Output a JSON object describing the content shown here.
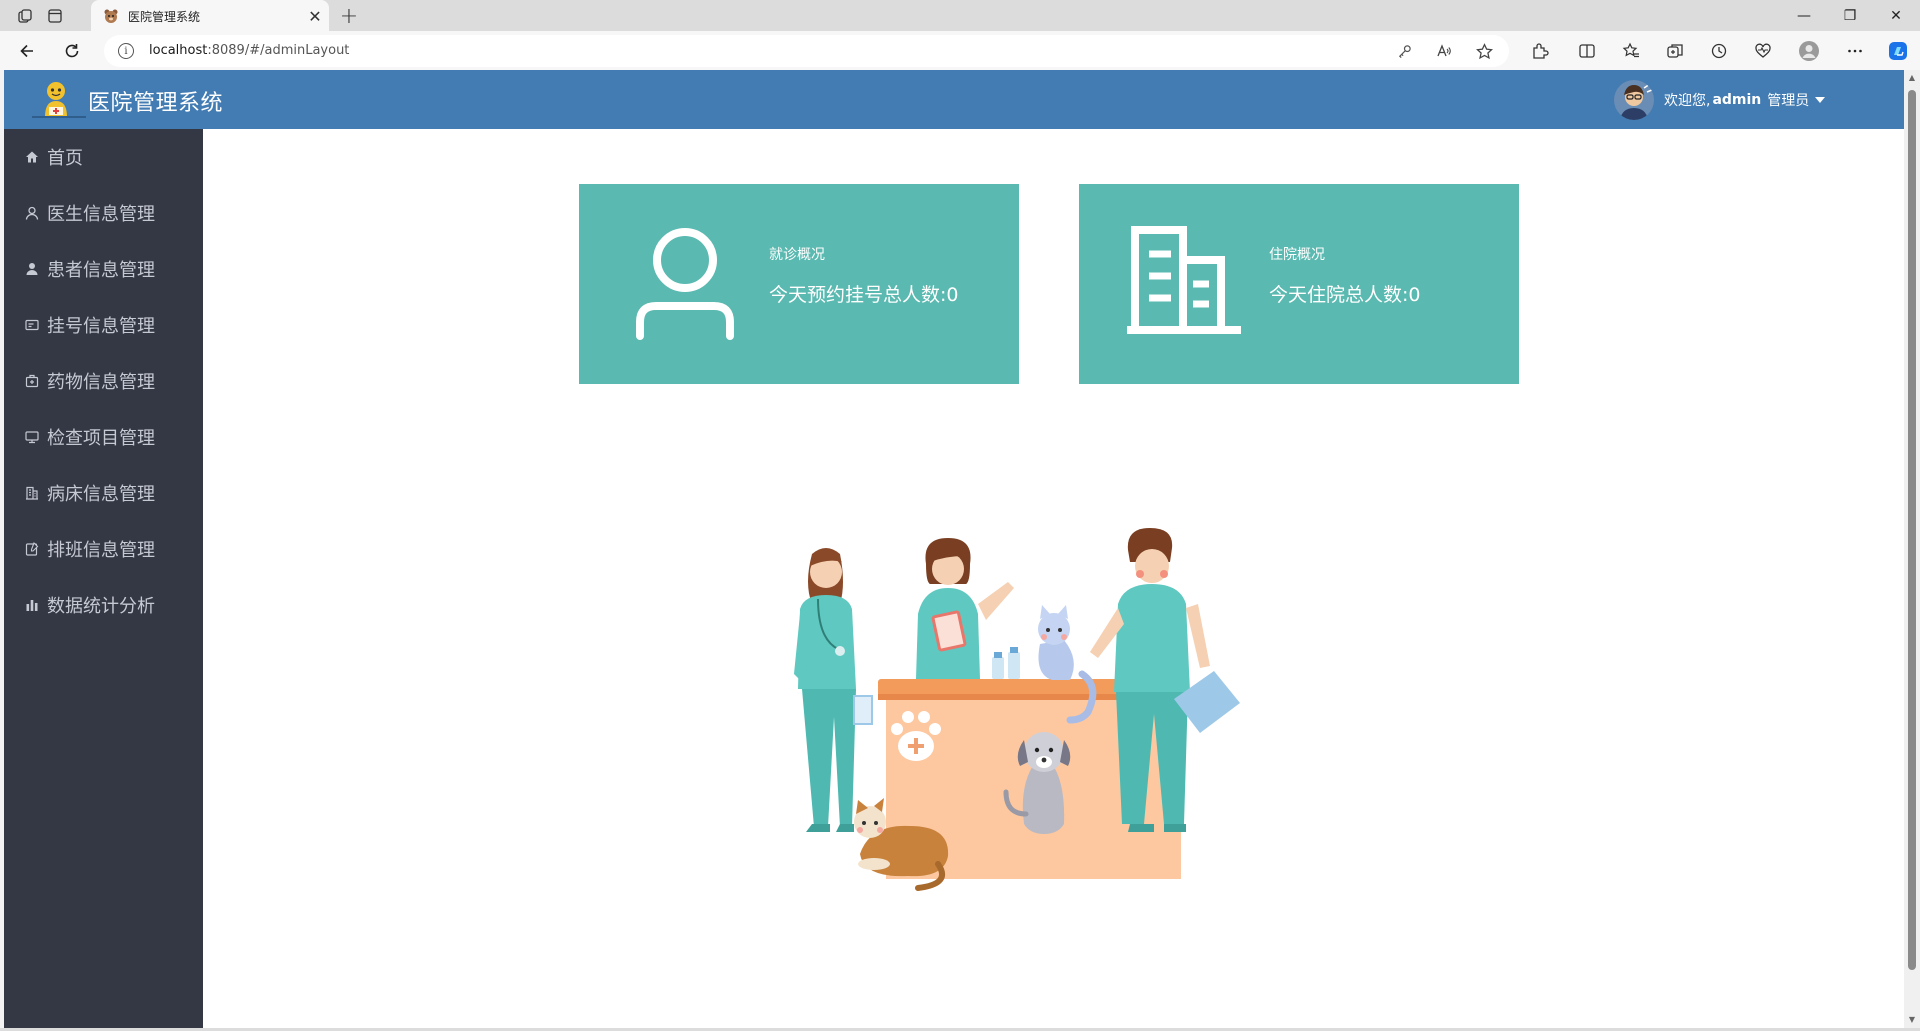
{
  "browser": {
    "tab_title": "医院管理系统",
    "tab_close": "✕",
    "new_tab": "+",
    "url_host": "localhost",
    "url_rest": ":8089/#/adminLayout",
    "info_icon": "i",
    "window_controls": {
      "minimize": "—",
      "restore": "❐",
      "close": "✕"
    }
  },
  "header": {
    "title": "医院管理系统",
    "welcome": "欢迎您,",
    "username": "admin",
    "role": "管理员"
  },
  "sidebar": {
    "items": [
      {
        "label": "首页",
        "icon": "home-icon"
      },
      {
        "label": "医生信息管理",
        "icon": "user-outline-icon"
      },
      {
        "label": "患者信息管理",
        "icon": "user-solid-icon"
      },
      {
        "label": "挂号信息管理",
        "icon": "ticket-icon"
      },
      {
        "label": "药物信息管理",
        "icon": "medicine-box-icon"
      },
      {
        "label": "检查项目管理",
        "icon": "monitor-icon"
      },
      {
        "label": "病床信息管理",
        "icon": "building-icon"
      },
      {
        "label": "排班信息管理",
        "icon": "calendar-edit-icon"
      },
      {
        "label": "数据统计分析",
        "icon": "bar-chart-icon"
      }
    ]
  },
  "cards": [
    {
      "heading": "就诊概况",
      "stat": "今天预约挂号总人数:0",
      "icon": "user-icon",
      "color": "#5ab9b0"
    },
    {
      "heading": "住院概况",
      "stat": "今天住院总人数:0",
      "icon": "building-icon",
      "color": "#5ab9b0"
    }
  ],
  "colors": {
    "topbar": "#437cb3",
    "sidebar": "#343744",
    "card": "#5ab9b0"
  }
}
